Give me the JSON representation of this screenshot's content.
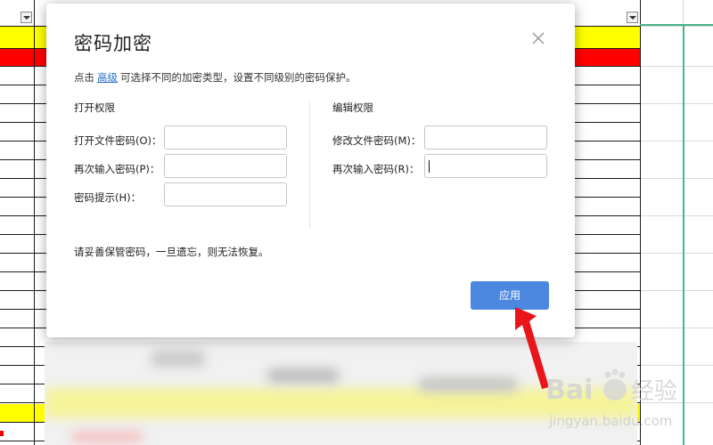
{
  "dialog": {
    "title": "密码加密",
    "info_prefix": "点击",
    "info_link": "高级",
    "info_suffix": "可选择不同的加密类型，设置不同级别的密码保护。",
    "open_section": {
      "title": "打开权限",
      "password_label": "打开文件密码(O)：",
      "confirm_label": "再次输入密码(P)：",
      "hint_label": "密码提示(H)："
    },
    "edit_section": {
      "title": "编辑权限",
      "password_label": "修改文件密码(M)：",
      "confirm_label": "再次输入密码(R)："
    },
    "warning": "请妥善保管密码，一旦遗忘，则无法恢复。",
    "apply_label": "应用"
  },
  "icons": [
    "close-icon",
    "filter-dropdown-icon",
    "red-arrow-icon",
    "baidu-paw-icon"
  ],
  "colors": {
    "accent": "#4d88e0",
    "link": "#2a6fc9",
    "yellow_row": "#ffff00",
    "red_row": "#ff0000",
    "selection_green": "#4bb58a",
    "arrow_red": "#e8151b"
  },
  "watermark": {
    "brand": "Bai",
    "brand_suffix": "经验",
    "url": "jingyan.baidu.com"
  }
}
